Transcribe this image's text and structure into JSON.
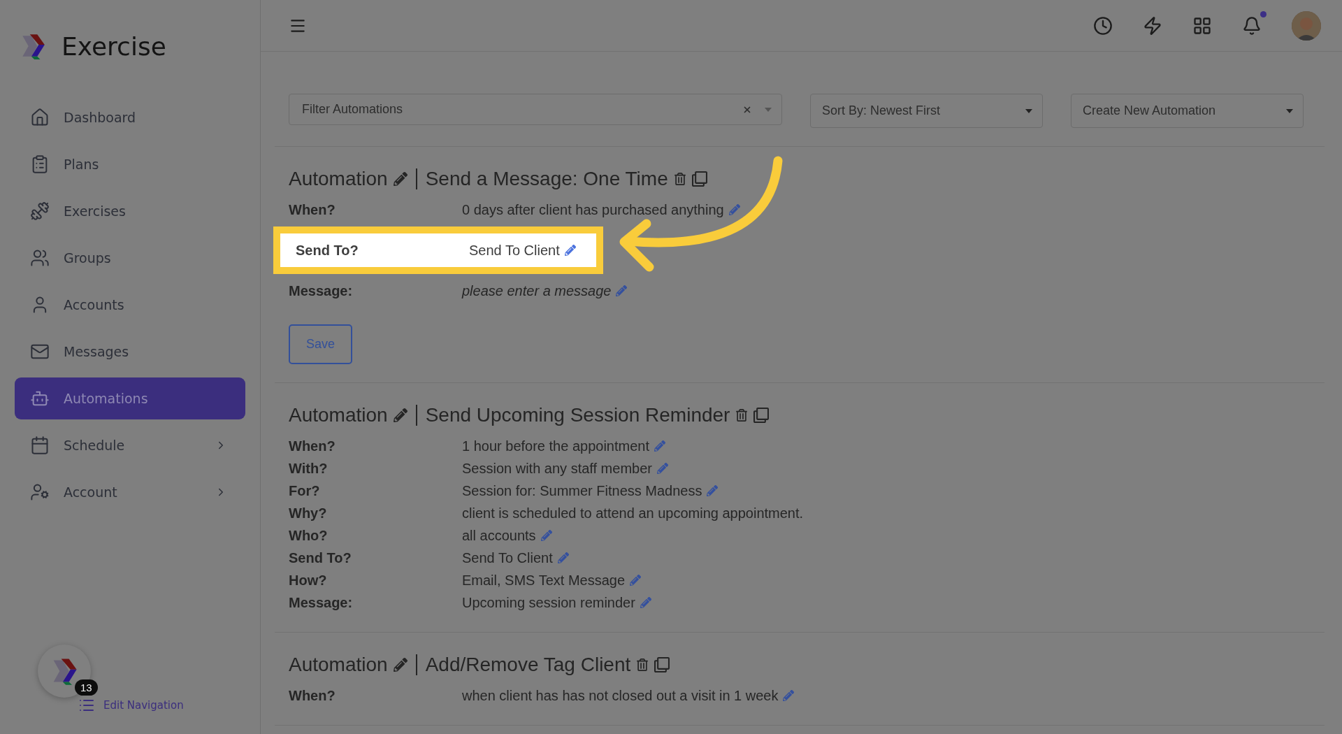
{
  "app": {
    "name": "Exercise"
  },
  "sidebar": {
    "items": [
      {
        "label": "Dashboard",
        "selected": false,
        "submenu": false
      },
      {
        "label": "Plans",
        "selected": false,
        "submenu": false
      },
      {
        "label": "Exercises",
        "selected": false,
        "submenu": false
      },
      {
        "label": "Groups",
        "selected": false,
        "submenu": false
      },
      {
        "label": "Accounts",
        "selected": false,
        "submenu": false
      },
      {
        "label": "Messages",
        "selected": false,
        "submenu": false
      },
      {
        "label": "Automations",
        "selected": true,
        "submenu": false
      },
      {
        "label": "Schedule",
        "selected": false,
        "submenu": true
      },
      {
        "label": "Account",
        "selected": false,
        "submenu": true
      }
    ],
    "launcher_badge": "13",
    "edit_navigation": "Edit Navigation"
  },
  "header": {
    "notifications_unread": true
  },
  "toolbar": {
    "filter": {
      "placeholder": "Filter Automations"
    },
    "sort": "Sort By: Newest First",
    "create": "Create New Automation"
  },
  "automations": [
    {
      "label": "Automation",
      "title": "Send a Message: One Time",
      "save": "Save",
      "rows": [
        {
          "label": "When?",
          "value": "0 days after client has purchased anything",
          "editable": true,
          "empty": false,
          "highlighted": false
        },
        {
          "label": "Send To?",
          "value": "Send To Client",
          "editable": true,
          "empty": false,
          "highlighted": true
        },
        {
          "label": "Message:",
          "value": "please enter a message",
          "editable": true,
          "empty": true,
          "highlighted": false
        }
      ]
    },
    {
      "label": "Automation",
      "title": "Send Upcoming Session Reminder",
      "rows": [
        {
          "label": "When?",
          "value": "1 hour before the appointment",
          "editable": true,
          "empty": false,
          "highlighted": false
        },
        {
          "label": "With?",
          "value": "Session with any staff member",
          "editable": true,
          "empty": false,
          "highlighted": false
        },
        {
          "label": "For?",
          "value": "Session for: Summer Fitness Madness",
          "editable": true,
          "empty": false,
          "highlighted": false
        },
        {
          "label": "Why?",
          "value": "client is scheduled to attend an upcoming appointment.",
          "editable": false,
          "empty": false,
          "highlighted": false
        },
        {
          "label": "Who?",
          "value": "all accounts",
          "editable": true,
          "empty": false,
          "highlighted": false
        },
        {
          "label": "Send To?",
          "value": "Send To Client",
          "editable": true,
          "empty": false,
          "highlighted": false
        },
        {
          "label": "How?",
          "value": "Email, SMS Text Message",
          "editable": true,
          "empty": false,
          "highlighted": false
        },
        {
          "label": "Message:",
          "value": "Upcoming session reminder",
          "editable": true,
          "empty": false,
          "highlighted": false
        }
      ]
    },
    {
      "label": "Automation",
      "title": "Add/Remove Tag Client",
      "rows": [
        {
          "label": "When?",
          "value": "when client has has not closed out a visit in 1 week",
          "editable": true,
          "empty": false,
          "highlighted": false
        }
      ]
    }
  ]
}
